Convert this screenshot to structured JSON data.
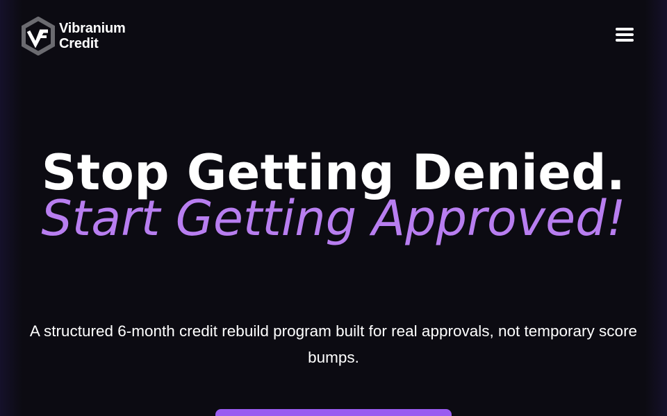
{
  "brand": {
    "line1": "Vibranium",
    "line2": "Credit"
  },
  "header": {
    "menu_icon": "hamburger-menu-icon"
  },
  "hero": {
    "headline_line1": "Stop Getting Denied.",
    "headline_line2": "Start Getting Approved!",
    "subtext": "A structured 6-month credit rebuild program built for real approvals, not temporary score bumps."
  },
  "colors": {
    "background": "#0c0b12",
    "accent": "#b87ef0",
    "button": "#9a5cf0",
    "text": "#ffffff"
  }
}
